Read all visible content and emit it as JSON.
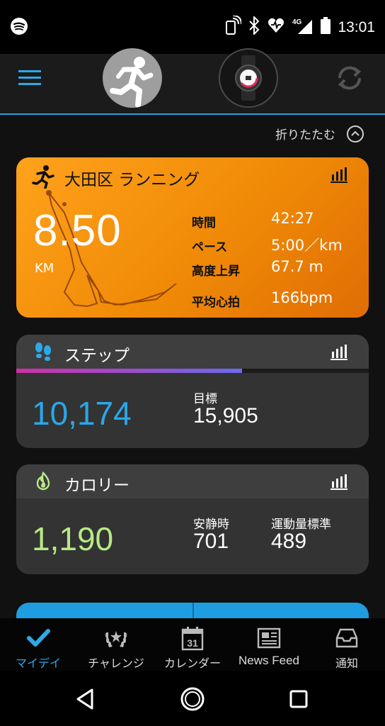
{
  "status_bar": {
    "time": "13:01",
    "network": "4G",
    "icons": [
      "spotify-icon",
      "nfc-icon",
      "bluetooth-icon",
      "heart-icon",
      "signal-icon",
      "battery-icon"
    ]
  },
  "app_bar": {
    "icons": [
      "menu-icon",
      "avatar-runner-icon",
      "watch-device-icon",
      "sync-icon"
    ]
  },
  "collapse": {
    "label": "折りたたむ"
  },
  "running_card": {
    "title": "大田区 ランニング",
    "distance": "8.50",
    "unit": "KM",
    "stats": [
      {
        "label": "時間",
        "value": "42:27"
      },
      {
        "label": "ペース",
        "value": "5:00／km"
      },
      {
        "label": "高度上昇",
        "value": "67.7 m"
      },
      {
        "label": "平均心拍",
        "value": "166bpm"
      }
    ]
  },
  "steps_card": {
    "title": "ステップ",
    "value": "10,174",
    "goal_label": "目標",
    "goal_value": "15,905",
    "progress": 0.64
  },
  "calories_card": {
    "title": "カロリー",
    "value": "1,190",
    "resting_label": "安静時",
    "resting_value": "701",
    "active_label": "運動量標準",
    "active_value": "489"
  },
  "tabs": [
    {
      "label": "マイデイ",
      "icon": "check-icon",
      "active": true
    },
    {
      "label": "チャレンジ",
      "icon": "laurel-icon",
      "active": false
    },
    {
      "label": "カレンダー",
      "icon": "calendar-icon",
      "day": "31",
      "active": false
    },
    {
      "label": "News Feed",
      "icon": "newspaper-icon",
      "active": false
    },
    {
      "label": "通知",
      "icon": "inbox-icon",
      "active": false
    }
  ],
  "colors": {
    "accent": "#2ea8e6",
    "run_orange": "#f59207",
    "steps_blue": "#29a8e8",
    "calories_green": "#b6ea85"
  }
}
